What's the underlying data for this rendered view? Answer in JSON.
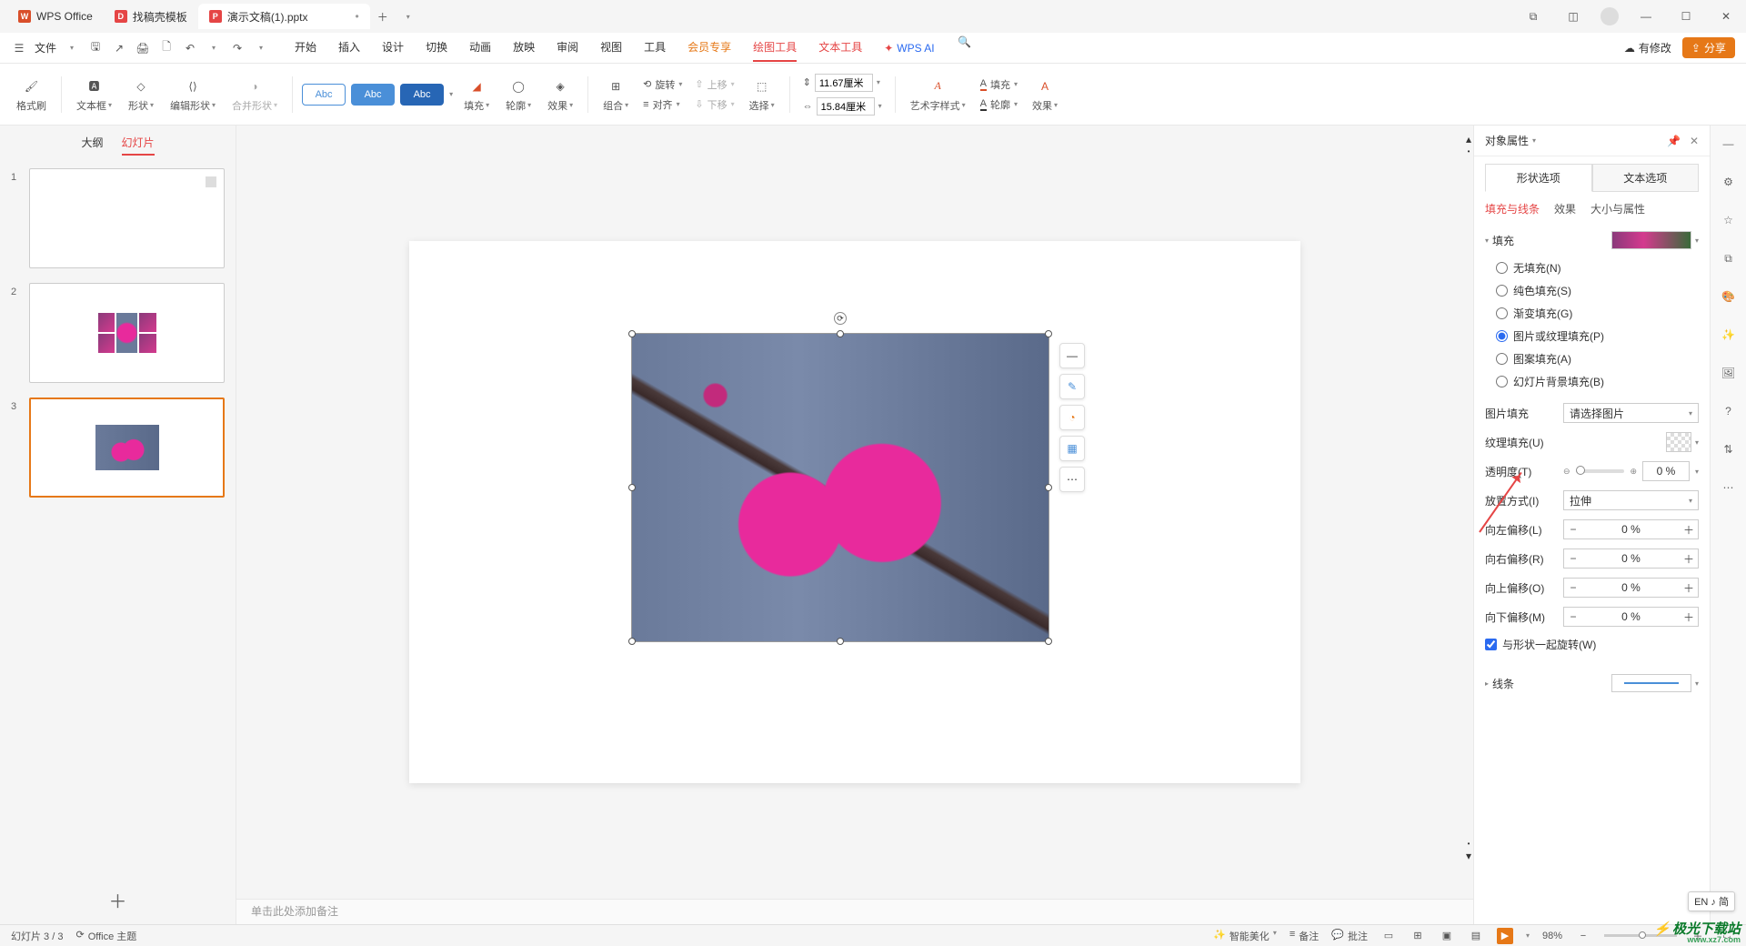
{
  "titlebar": {
    "app_name": "WPS Office",
    "tab_templates": "找稿壳模板",
    "tab_doc": "演示文稿(1).pptx"
  },
  "menubar": {
    "file": "文件",
    "tabs": [
      "开始",
      "插入",
      "设计",
      "切换",
      "动画",
      "放映",
      "审阅",
      "视图",
      "工具",
      "会员专享",
      "绘图工具",
      "文本工具"
    ],
    "wps_ai": "WPS AI",
    "modified": "有修改",
    "share": "分享"
  },
  "ribbon": {
    "format_painter": "格式刷",
    "textbox": "文本框",
    "shape": "形状",
    "edit_shape": "编辑形状",
    "merge_shape": "合并形状",
    "style_label": "Abc",
    "fill": "填充",
    "outline": "轮廓",
    "effect": "效果",
    "group": "组合",
    "rotate": "旋转",
    "align": "对齐",
    "move_up": "上移",
    "move_down": "下移",
    "select": "选择",
    "height": "11.67厘米",
    "width": "15.84厘米",
    "wordart": "艺术字样式",
    "fill2": "填充",
    "outline2": "轮廓",
    "effect2": "效果"
  },
  "thumbs": {
    "tab_outline": "大纲",
    "tab_slides": "幻灯片",
    "items": [
      {
        "num": "1"
      },
      {
        "num": "2"
      },
      {
        "num": "3"
      }
    ]
  },
  "notes_placeholder": "单击此处添加备注",
  "panel": {
    "title": "对象属性",
    "tab_shape": "形状选项",
    "tab_text": "文本选项",
    "sub_fill": "填充与线条",
    "sub_effect": "效果",
    "sub_size": "大小与属性",
    "sect_fill": "填充",
    "radio_none": "无填充(N)",
    "radio_solid": "纯色填充(S)",
    "radio_gradient": "渐变填充(G)",
    "radio_picture": "图片或纹理填充(P)",
    "radio_pattern": "图案填充(A)",
    "radio_slidebg": "幻灯片背景填充(B)",
    "pic_fill": "图片填充",
    "pic_fill_sel": "请选择图片",
    "texture_fill": "纹理填充(U)",
    "transparency": "透明度(T)",
    "transparency_val": "0",
    "pct": "%",
    "placement": "放置方式(I)",
    "placement_val": "拉伸",
    "off_l": "向左偏移(L)",
    "off_r": "向右偏移(R)",
    "off_t": "向上偏移(O)",
    "off_b": "向下偏移(M)",
    "offset_val": "0 %",
    "rotate_with": "与形状一起旋转(W)",
    "sect_line": "线条"
  },
  "status": {
    "slide_count": "幻灯片 3 / 3",
    "theme": "Office 主题",
    "smart_beautify": "智能美化",
    "notes": "备注",
    "comments": "批注",
    "zoom": "98%"
  },
  "lang_pill": "EN ♪ 简",
  "watermark": {
    "main": "极光下载站",
    "sub": "www.xz7.com"
  }
}
